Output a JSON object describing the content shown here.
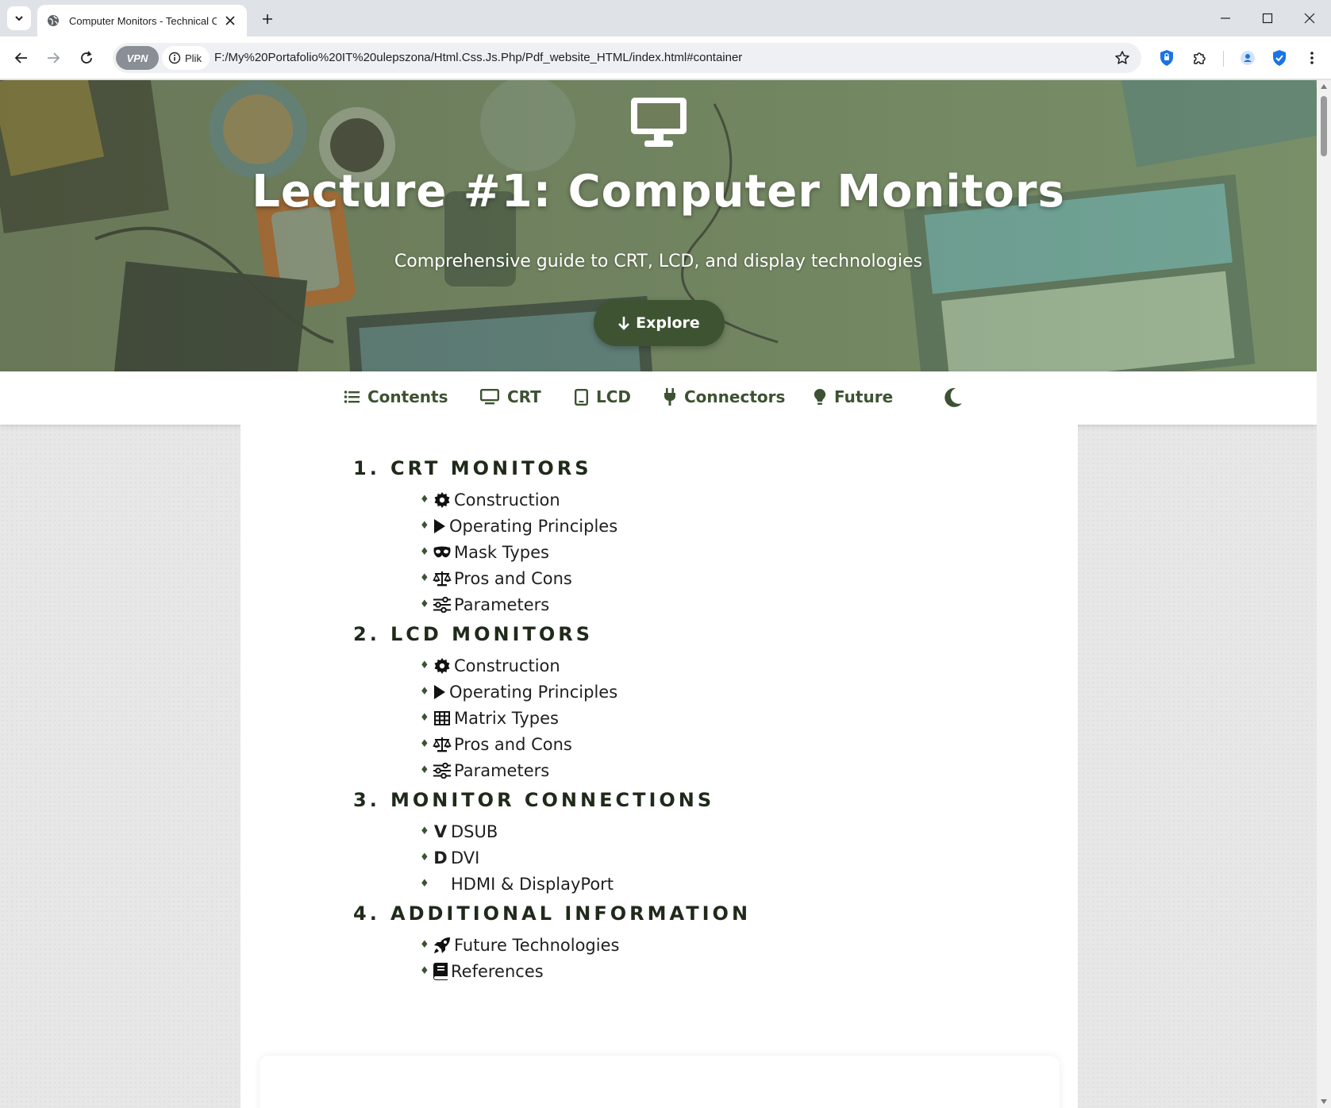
{
  "browser": {
    "tab_title": "Computer Monitors - Technical Ov",
    "vpn_label": "VPN",
    "site_chip_label": "Plik",
    "url": "F:/My%20Portafolio%20IT%20ulepszona/Html.Css.Js.Php/Pdf_website_HTML/index.html#container"
  },
  "hero": {
    "icon": "desktop-monitor-icon",
    "title": "Lecture #1: Computer Monitors",
    "subtitle": "Comprehensive guide to CRT, LCD, and display technologies",
    "explore_label": "Explore"
  },
  "nav": {
    "items": [
      {
        "label": "Contents",
        "icon": "list-icon"
      },
      {
        "label": "CRT",
        "icon": "desktop-icon"
      },
      {
        "label": "LCD",
        "icon": "tablet-icon"
      },
      {
        "label": "Connectors",
        "icon": "plug-icon"
      },
      {
        "label": "Future",
        "icon": "lightbulb-icon"
      }
    ],
    "theme_toggle_icon": "moon-icon"
  },
  "toc": {
    "sections": [
      {
        "number": "1.",
        "title": "CRT MONITORS",
        "items": [
          {
            "label": "Construction",
            "icon": "gear-icon"
          },
          {
            "label": "Operating Principles",
            "icon": "play-icon"
          },
          {
            "label": "Mask Types",
            "icon": "mask-icon"
          },
          {
            "label": "Pros and Cons",
            "icon": "scale-icon"
          },
          {
            "label": "Parameters",
            "icon": "sliders-icon"
          }
        ]
      },
      {
        "number": "2.",
        "title": "LCD MONITORS",
        "items": [
          {
            "label": "Construction",
            "icon": "gear-icon"
          },
          {
            "label": "Operating Principles",
            "icon": "play-icon"
          },
          {
            "label": "Matrix Types",
            "icon": "table-icon"
          },
          {
            "label": "Pros and Cons",
            "icon": "scale-icon"
          },
          {
            "label": "Parameters",
            "icon": "sliders-icon"
          }
        ]
      },
      {
        "number": "3.",
        "title": "MONITOR CONNECTIONS",
        "items": [
          {
            "label": "DSUB",
            "icon": "v-letter-icon",
            "glyph": "V"
          },
          {
            "label": "DVI",
            "icon": "d-letter-icon",
            "glyph": "D"
          },
          {
            "label": "HDMI & DisplayPort",
            "icon": "blank-icon"
          }
        ]
      },
      {
        "number": "4.",
        "title": "ADDITIONAL INFORMATION",
        "items": [
          {
            "label": "Future Technologies",
            "icon": "rocket-icon"
          },
          {
            "label": "References",
            "icon": "book-icon"
          }
        ]
      }
    ]
  },
  "colors": {
    "accent_dark_green": "#3d5232",
    "button_green": "#3e5332",
    "heading_text": "#1f2a1a"
  }
}
